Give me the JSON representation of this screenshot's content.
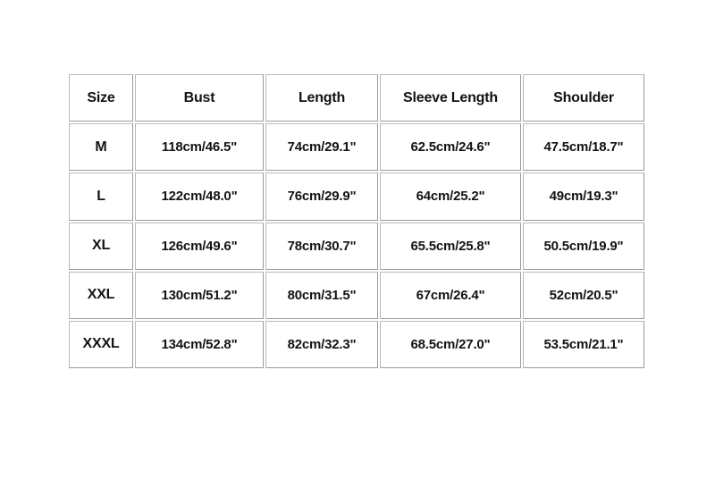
{
  "table": {
    "name": "size-chart",
    "columns": [
      "Size",
      "Bust",
      "Length",
      "Sleeve Length",
      "Shoulder"
    ],
    "rows": [
      {
        "size": "M",
        "bust": "118cm/46.5\"",
        "length": "74cm/29.1\"",
        "sleeve": "62.5cm/24.6\"",
        "shoulder": "47.5cm/18.7\""
      },
      {
        "size": "L",
        "bust": "122cm/48.0\"",
        "length": "76cm/29.9\"",
        "sleeve": "64cm/25.2\"",
        "shoulder": "49cm/19.3\""
      },
      {
        "size": "XL",
        "bust": "126cm/49.6\"",
        "length": "78cm/30.7\"",
        "sleeve": "65.5cm/25.8\"",
        "shoulder": "50.5cm/19.9\""
      },
      {
        "size": "XXL",
        "bust": "130cm/51.2\"",
        "length": "80cm/31.5\"",
        "sleeve": "67cm/26.4\"",
        "shoulder": "52cm/20.5\""
      },
      {
        "size": "XXXL",
        "bust": "134cm/52.8\"",
        "length": "82cm/32.3\"",
        "sleeve": "68.5cm/27.0\"",
        "shoulder": "53.5cm/21.1\""
      }
    ]
  },
  "colors": {
    "background": "#ffffff",
    "cell_background": "#ffffff",
    "border": "#b9b9b9",
    "border_shadow": "#9a9a9a",
    "text": "#131313"
  }
}
